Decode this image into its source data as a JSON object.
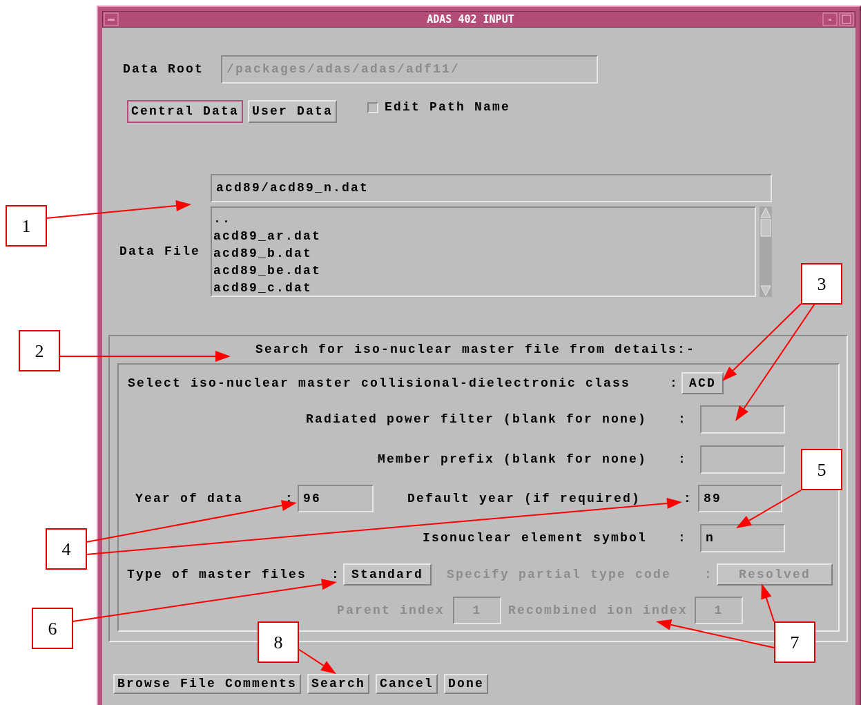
{
  "window": {
    "title": "ADAS 402 INPUT"
  },
  "data_root": {
    "label": "Data Root",
    "value": "/packages/adas/adas/adf11/",
    "disabled": true
  },
  "source_buttons": [
    {
      "label": "Central Data",
      "selected": true
    },
    {
      "label": "User Data",
      "selected": false
    }
  ],
  "edit_path": {
    "label": "Edit Path Name",
    "checked": false
  },
  "data_file": {
    "label": "Data File",
    "value": "acd89/acd89_n.dat",
    "items": [
      "..",
      "acd89_ar.dat",
      "acd89_b.dat",
      "acd89_be.dat",
      "acd89_c.dat"
    ]
  },
  "search_group": {
    "title": "Search for iso-nuclear master file from details:-",
    "class_select": {
      "label": "Select iso-nuclear master collisional-dielectronic class",
      "colon": ":",
      "button": "ACD"
    },
    "radiated_filter": {
      "label": "Radiated power filter (blank for none)",
      "colon": ":"
    },
    "member_prefix": {
      "label": "Member prefix (blank for none)",
      "colon": ":"
    },
    "year": {
      "label": "Year of data",
      "colon": ":",
      "value": "96"
    },
    "default_year": {
      "label": "Default year (if required)",
      "colon": ":",
      "value": "89"
    },
    "element_symbol": {
      "label": "Isonuclear element symbol",
      "colon": ":",
      "value": "n"
    },
    "master_type": {
      "label": "Type of master files",
      "colon": ":",
      "button": "Standard"
    },
    "partial_type": {
      "label": "Specify partial type code",
      "colon": ":",
      "button": "Resolved",
      "disabled": true
    },
    "parent_index": {
      "label": "Parent index",
      "value": "1",
      "disabled": true
    },
    "recombined_index": {
      "label": "Recombined ion index",
      "value": "1",
      "disabled": true
    }
  },
  "buttons": [
    "Browse File Comments",
    "Search",
    "Cancel",
    "Done"
  ],
  "callouts": [
    {
      "label": "1"
    },
    {
      "label": "2"
    },
    {
      "label": "3"
    },
    {
      "label": "4"
    },
    {
      "label": "5"
    },
    {
      "label": "6"
    },
    {
      "label": "7"
    },
    {
      "label": "8"
    }
  ]
}
